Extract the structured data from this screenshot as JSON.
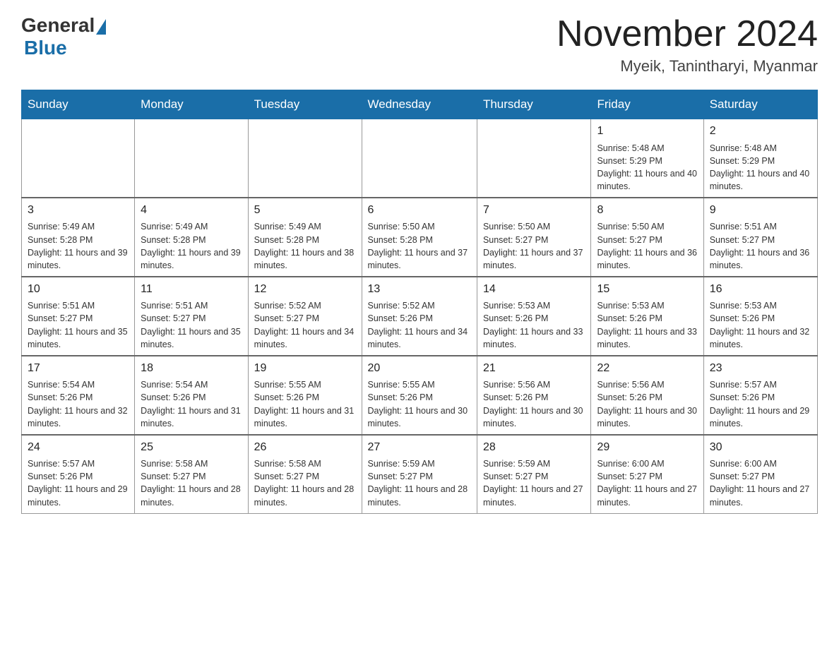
{
  "header": {
    "logo_general": "General",
    "logo_blue": "Blue",
    "month_title": "November 2024",
    "location": "Myeik, Tanintharyi, Myanmar"
  },
  "days_of_week": [
    "Sunday",
    "Monday",
    "Tuesday",
    "Wednesday",
    "Thursday",
    "Friday",
    "Saturday"
  ],
  "weeks": [
    [
      {
        "day": "",
        "info": ""
      },
      {
        "day": "",
        "info": ""
      },
      {
        "day": "",
        "info": ""
      },
      {
        "day": "",
        "info": ""
      },
      {
        "day": "",
        "info": ""
      },
      {
        "day": "1",
        "info": "Sunrise: 5:48 AM\nSunset: 5:29 PM\nDaylight: 11 hours and 40 minutes."
      },
      {
        "day": "2",
        "info": "Sunrise: 5:48 AM\nSunset: 5:29 PM\nDaylight: 11 hours and 40 minutes."
      }
    ],
    [
      {
        "day": "3",
        "info": "Sunrise: 5:49 AM\nSunset: 5:28 PM\nDaylight: 11 hours and 39 minutes."
      },
      {
        "day": "4",
        "info": "Sunrise: 5:49 AM\nSunset: 5:28 PM\nDaylight: 11 hours and 39 minutes."
      },
      {
        "day": "5",
        "info": "Sunrise: 5:49 AM\nSunset: 5:28 PM\nDaylight: 11 hours and 38 minutes."
      },
      {
        "day": "6",
        "info": "Sunrise: 5:50 AM\nSunset: 5:28 PM\nDaylight: 11 hours and 37 minutes."
      },
      {
        "day": "7",
        "info": "Sunrise: 5:50 AM\nSunset: 5:27 PM\nDaylight: 11 hours and 37 minutes."
      },
      {
        "day": "8",
        "info": "Sunrise: 5:50 AM\nSunset: 5:27 PM\nDaylight: 11 hours and 36 minutes."
      },
      {
        "day": "9",
        "info": "Sunrise: 5:51 AM\nSunset: 5:27 PM\nDaylight: 11 hours and 36 minutes."
      }
    ],
    [
      {
        "day": "10",
        "info": "Sunrise: 5:51 AM\nSunset: 5:27 PM\nDaylight: 11 hours and 35 minutes."
      },
      {
        "day": "11",
        "info": "Sunrise: 5:51 AM\nSunset: 5:27 PM\nDaylight: 11 hours and 35 minutes."
      },
      {
        "day": "12",
        "info": "Sunrise: 5:52 AM\nSunset: 5:27 PM\nDaylight: 11 hours and 34 minutes."
      },
      {
        "day": "13",
        "info": "Sunrise: 5:52 AM\nSunset: 5:26 PM\nDaylight: 11 hours and 34 minutes."
      },
      {
        "day": "14",
        "info": "Sunrise: 5:53 AM\nSunset: 5:26 PM\nDaylight: 11 hours and 33 minutes."
      },
      {
        "day": "15",
        "info": "Sunrise: 5:53 AM\nSunset: 5:26 PM\nDaylight: 11 hours and 33 minutes."
      },
      {
        "day": "16",
        "info": "Sunrise: 5:53 AM\nSunset: 5:26 PM\nDaylight: 11 hours and 32 minutes."
      }
    ],
    [
      {
        "day": "17",
        "info": "Sunrise: 5:54 AM\nSunset: 5:26 PM\nDaylight: 11 hours and 32 minutes."
      },
      {
        "day": "18",
        "info": "Sunrise: 5:54 AM\nSunset: 5:26 PM\nDaylight: 11 hours and 31 minutes."
      },
      {
        "day": "19",
        "info": "Sunrise: 5:55 AM\nSunset: 5:26 PM\nDaylight: 11 hours and 31 minutes."
      },
      {
        "day": "20",
        "info": "Sunrise: 5:55 AM\nSunset: 5:26 PM\nDaylight: 11 hours and 30 minutes."
      },
      {
        "day": "21",
        "info": "Sunrise: 5:56 AM\nSunset: 5:26 PM\nDaylight: 11 hours and 30 minutes."
      },
      {
        "day": "22",
        "info": "Sunrise: 5:56 AM\nSunset: 5:26 PM\nDaylight: 11 hours and 30 minutes."
      },
      {
        "day": "23",
        "info": "Sunrise: 5:57 AM\nSunset: 5:26 PM\nDaylight: 11 hours and 29 minutes."
      }
    ],
    [
      {
        "day": "24",
        "info": "Sunrise: 5:57 AM\nSunset: 5:26 PM\nDaylight: 11 hours and 29 minutes."
      },
      {
        "day": "25",
        "info": "Sunrise: 5:58 AM\nSunset: 5:27 PM\nDaylight: 11 hours and 28 minutes."
      },
      {
        "day": "26",
        "info": "Sunrise: 5:58 AM\nSunset: 5:27 PM\nDaylight: 11 hours and 28 minutes."
      },
      {
        "day": "27",
        "info": "Sunrise: 5:59 AM\nSunset: 5:27 PM\nDaylight: 11 hours and 28 minutes."
      },
      {
        "day": "28",
        "info": "Sunrise: 5:59 AM\nSunset: 5:27 PM\nDaylight: 11 hours and 27 minutes."
      },
      {
        "day": "29",
        "info": "Sunrise: 6:00 AM\nSunset: 5:27 PM\nDaylight: 11 hours and 27 minutes."
      },
      {
        "day": "30",
        "info": "Sunrise: 6:00 AM\nSunset: 5:27 PM\nDaylight: 11 hours and 27 minutes."
      }
    ]
  ]
}
